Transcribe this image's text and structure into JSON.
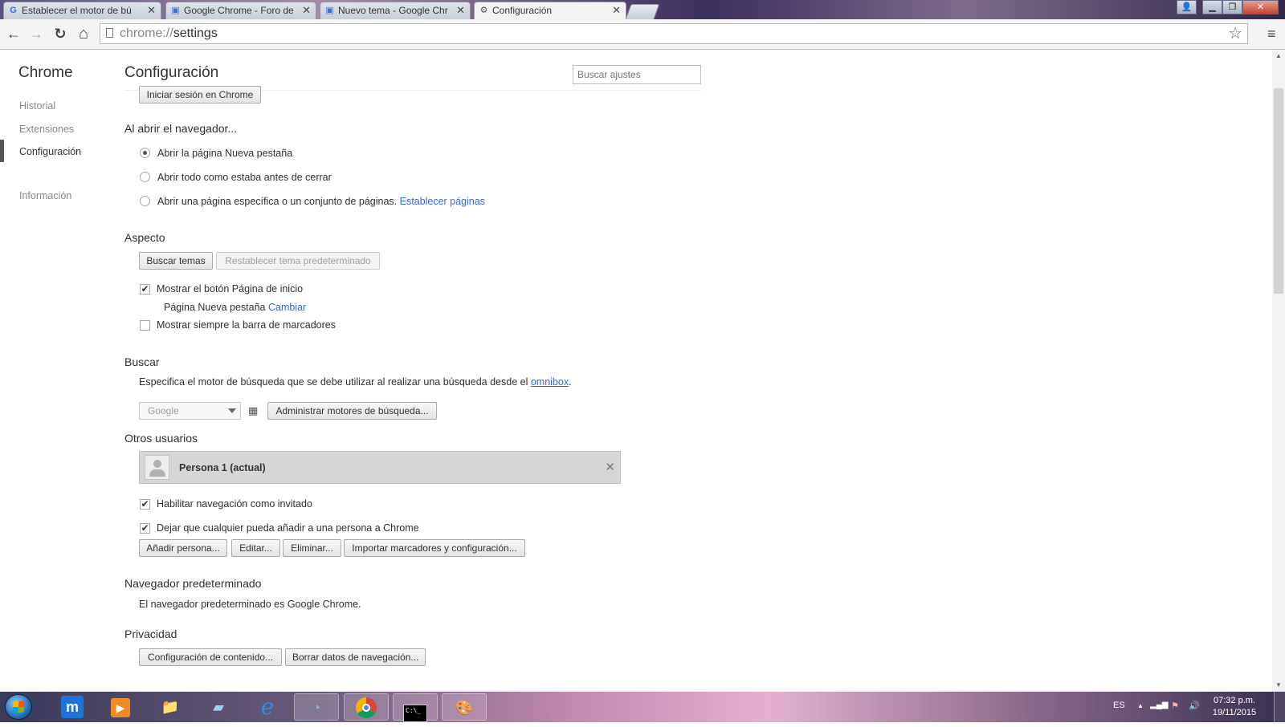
{
  "tabs": [
    {
      "title": "Establecer el motor de bú",
      "favicon": "G",
      "active": false
    },
    {
      "title": "Google Chrome - Foro de",
      "favicon": "▣",
      "active": false
    },
    {
      "title": "Nuevo tema - Google Chr",
      "favicon": "▣",
      "active": false
    },
    {
      "title": "Configuración",
      "favicon": "⚙",
      "active": true
    }
  ],
  "tab_close_glyph": "✕",
  "window_controls": {
    "user": "👤",
    "minimize": "▁",
    "maximize": "❐",
    "close": "✕"
  },
  "toolbar": {
    "back": "←",
    "forward": "→",
    "reload": "↻",
    "home": "⌂",
    "url_scheme": "chrome://",
    "url_path": "settings",
    "star": "☆",
    "menu": "≡"
  },
  "sidebar": {
    "brand": "Chrome",
    "items": [
      {
        "label": "Historial",
        "selected": false
      },
      {
        "label": "Extensiones",
        "selected": false
      },
      {
        "label": "Configuración",
        "selected": true
      },
      {
        "label": "Información",
        "selected": false
      }
    ]
  },
  "header": {
    "title": "Configuración",
    "search_placeholder": "Buscar ajustes"
  },
  "signin": {
    "button": "Iniciar sesión en Chrome"
  },
  "startup": {
    "title": "Al abrir el navegador...",
    "options": [
      {
        "label": "Abrir la página Nueva pestaña",
        "checked": true
      },
      {
        "label": "Abrir todo como estaba antes de cerrar",
        "checked": false
      },
      {
        "label": "Abrir una página específica o un conjunto de páginas.",
        "checked": false
      }
    ],
    "set_pages_link": "Establecer páginas"
  },
  "appearance": {
    "title": "Aspecto",
    "get_themes": "Buscar temas",
    "reset_theme": "Restablecer tema predeterminado",
    "show_home_button": {
      "label": "Mostrar el botón Página de inicio",
      "checked": true
    },
    "home_page_text": "Página Nueva pestaña",
    "change_link": "Cambiar",
    "show_bookmarks_bar": {
      "label": "Mostrar siempre la barra de marcadores",
      "checked": false
    }
  },
  "search": {
    "title": "Buscar",
    "description": "Especifica el motor de búsqueda que se debe utilizar al realizar una búsqueda desde el",
    "omnibox_link": "omnibox",
    "period": ".",
    "selected_engine": "Google",
    "policy_icon": "▦",
    "manage_button": "Administrar motores de búsqueda..."
  },
  "people": {
    "title": "Otros usuarios",
    "current_profile": "Persona 1 (actual)",
    "remove_glyph": "✕",
    "guest": {
      "label": "Habilitar navegación como invitado",
      "checked": true
    },
    "anyone_add": {
      "label": "Dejar que cualquier pueda añadir a una persona a Chrome",
      "checked": true
    },
    "add_button": "Añadir persona...",
    "edit_button": "Editar...",
    "delete_button": "Eliminar...",
    "import_button": "Importar marcadores y configuración..."
  },
  "default_browser": {
    "title": "Navegador predeterminado",
    "status": "El navegador predeterminado es Google Chrome."
  },
  "privacy": {
    "title": "Privacidad",
    "content_settings": "Configuración de contenido...",
    "clear_data": "Borrar datos de navegación..."
  },
  "check_glyph": "✔",
  "scroll": {
    "up": "▲",
    "down": "▼"
  },
  "taskbar": {
    "items": [
      "m",
      "▶",
      "📁",
      "▰",
      "e",
      "◔",
      "◉",
      "C:\\_",
      "🎨"
    ],
    "language": "ES",
    "tray_arrow": "▲",
    "signal": "▂▄▆",
    "flag": "⚑",
    "volume": "🔊",
    "time": "07:32 p.m.",
    "date": "19/11/2015"
  }
}
